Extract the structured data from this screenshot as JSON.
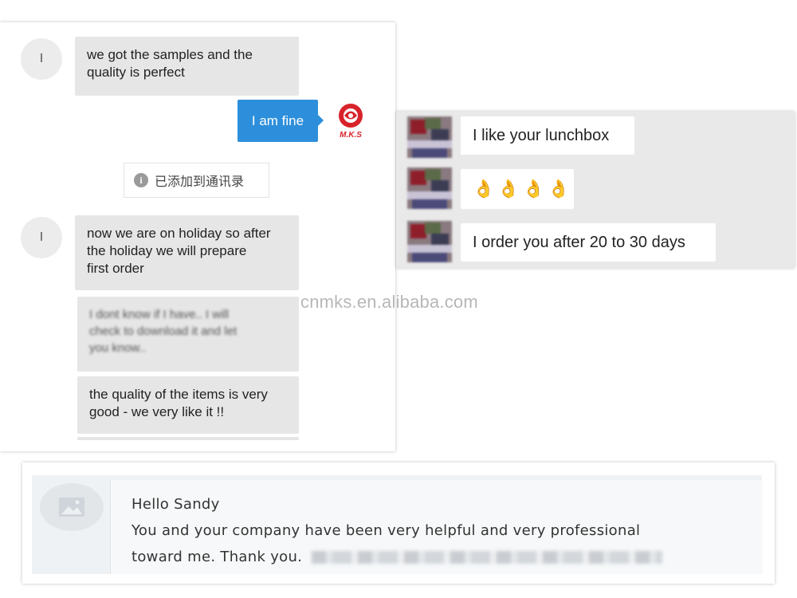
{
  "watermark": "cnmks.en.alibaba.com",
  "left_chat": {
    "avatar_initial": "I",
    "msg1": [
      "we got the samples and the",
      "quality is perfect"
    ],
    "reply": "I am fine",
    "logo_text": "M.K.S",
    "system_notice": "已添加到通讯录",
    "msg2": [
      "now we are on holiday so after",
      "the holiday we will prepare",
      "first order"
    ],
    "msg3_blurred": [
      "I dont know if I have.. I will",
      "check to download it and let",
      "you know.."
    ],
    "msg4": [
      "the quality of the items is very",
      "good - we very like it !!"
    ]
  },
  "right_chat": {
    "msg1": "I like your lunchbox",
    "msg2_emoji": [
      "👌",
      "👌",
      "👌",
      "👌"
    ],
    "msg3": "I order you after 20 to 30 days"
  },
  "bottom_message": {
    "greeting": "Hello Sandy",
    "line1": "You and your company have been very helpful and very professional",
    "line2": "toward me.  Thank you."
  },
  "colors": {
    "reply_bubble": "#2d8fdb",
    "gray_bubble": "#e6e6e6",
    "logo_red": "#d8232a"
  }
}
